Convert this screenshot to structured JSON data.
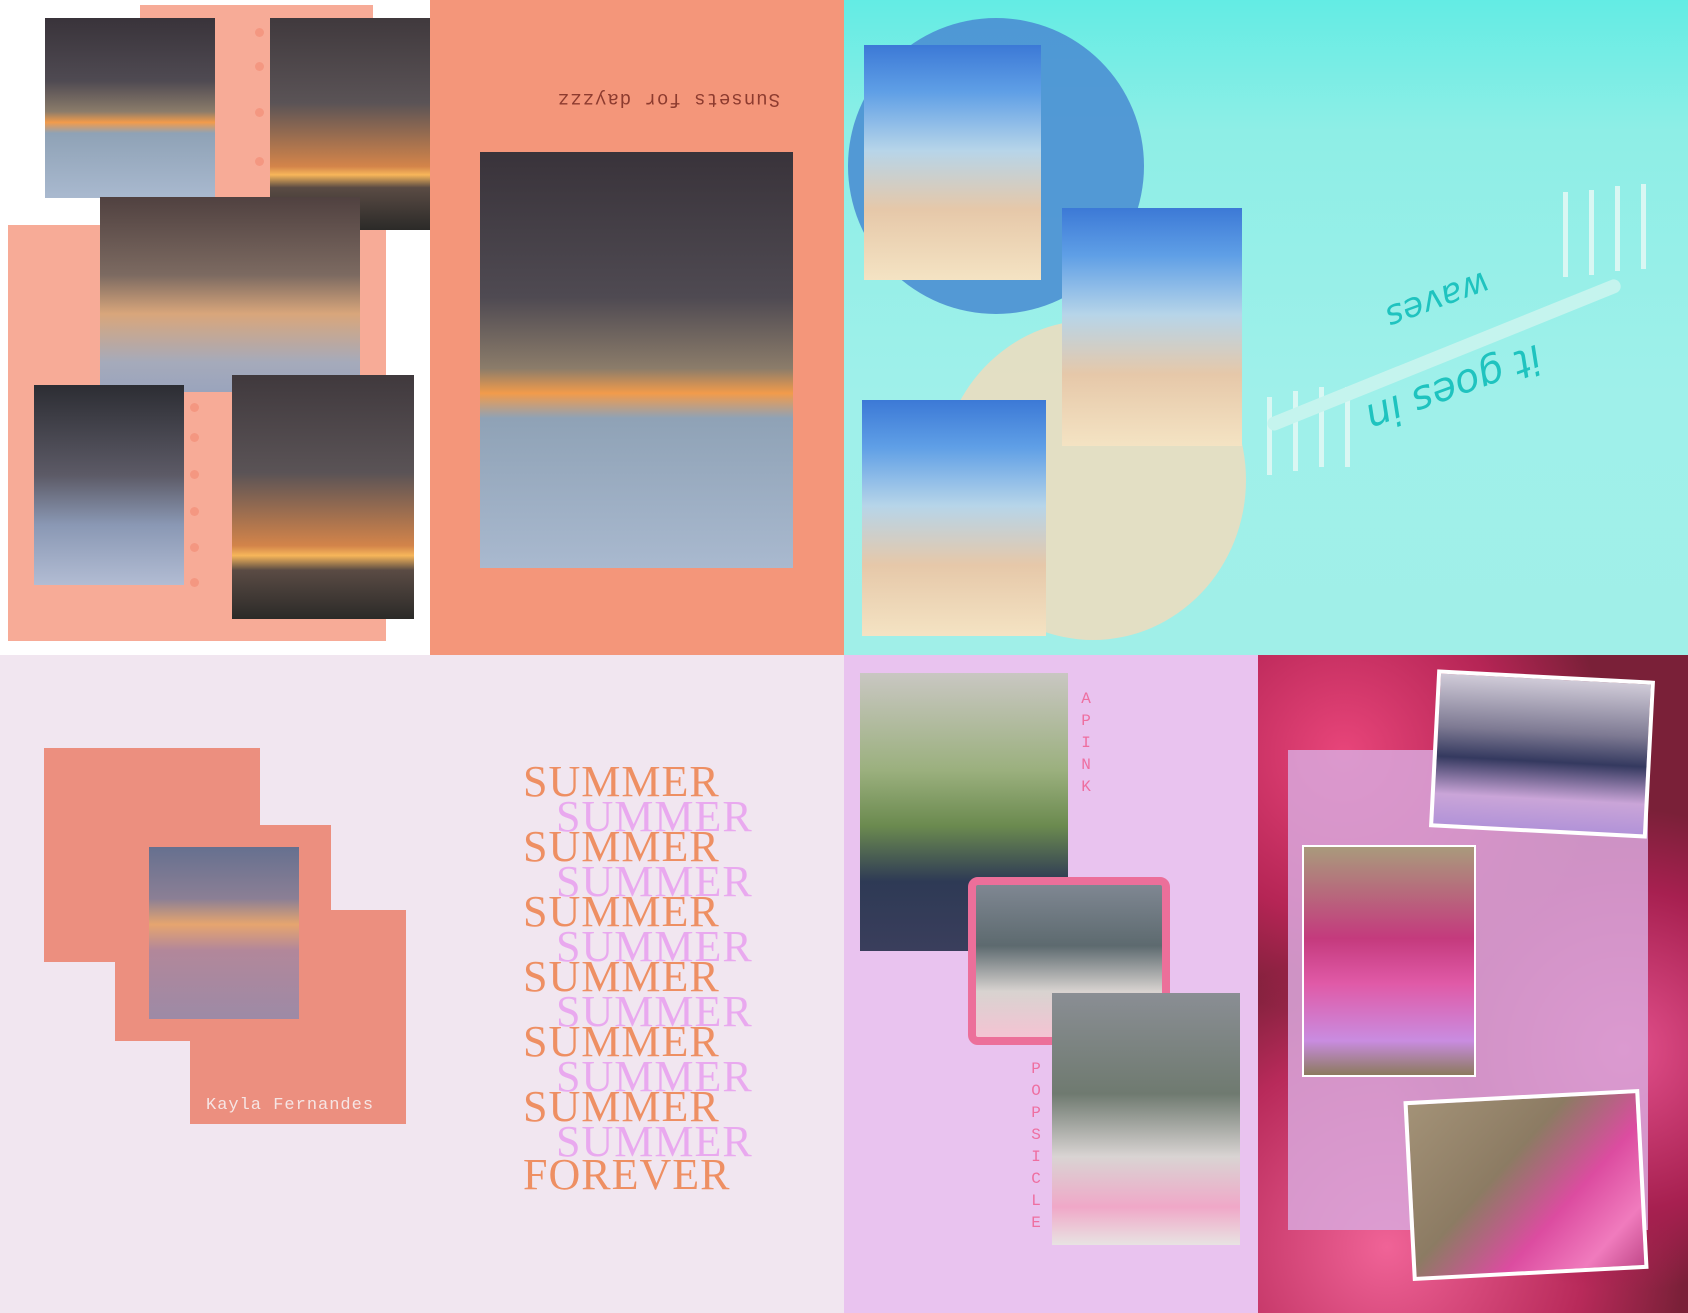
{
  "panels": {
    "sunsets": {
      "title": "Sunsets for dayzzz"
    },
    "waves": {
      "caption_line1": "it goes in",
      "caption_line2": "waves"
    },
    "summer": {
      "author": "Kayla Fernandes",
      "words": [
        "SUMMER",
        "SUMMER",
        "SUMMER",
        "SUMMER",
        "SUMMER",
        "SUMMER",
        "SUMMER",
        "SUMMER",
        "SUMMER",
        "SUMMER",
        "SUMMER",
        "SUMMER",
        "FOREVER"
      ]
    },
    "popsicle": {
      "label_top": "APINK",
      "label_bottom": "POPSICLE"
    }
  },
  "colors": {
    "peach": "#f4967a",
    "light_peach": "#f7ab97",
    "teal": "#63ece4",
    "lavender_bg": "#f1e6f0",
    "pink_panel": "#e9c3ef",
    "summer_orange": "#ee8f63",
    "summer_pink": "#e9a9ef"
  },
  "icons": [
    "decorative-dot",
    "handwritten-tally-marks"
  ]
}
